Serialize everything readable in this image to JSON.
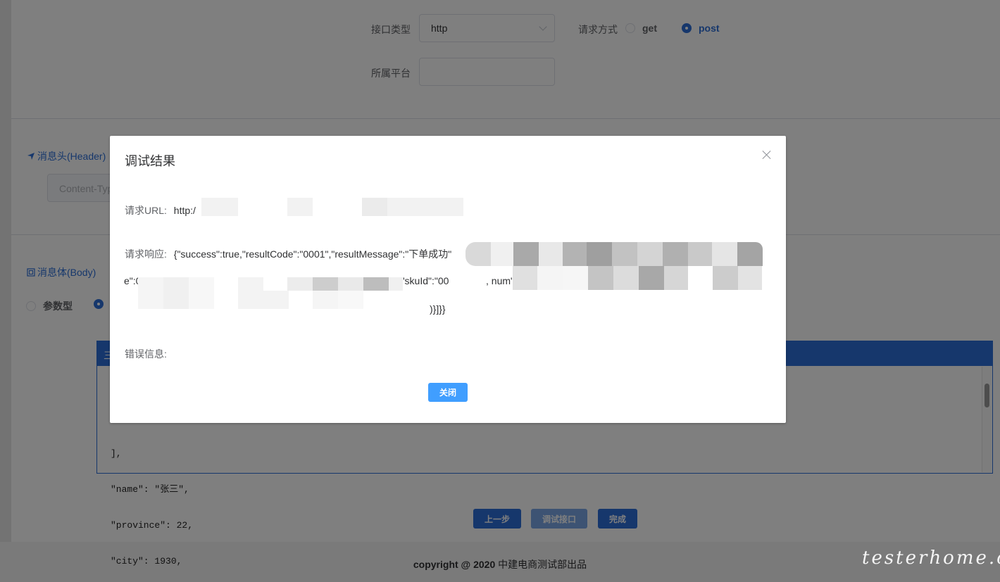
{
  "form": {
    "interface_type_label": "接口类型",
    "interface_type_value": "http",
    "method_label": "请求方式",
    "method_options": [
      "get",
      "post"
    ],
    "method_selected": "post",
    "platform_label": "所属平台"
  },
  "header_section": {
    "title": "消息头(Header)",
    "content_type_placeholder": "Content-Typ"
  },
  "body_section": {
    "title": "消息体(Body)",
    "type_options": [
      "参数型",
      ""
    ],
    "type_selected_index": 1,
    "menu_glyph": "三",
    "code_lines": [
      "],",
      "\"name\": \"张三\",",
      "\"province\": 22,",
      "\"city\": 1930,"
    ]
  },
  "actions": {
    "prev_label": "上一步",
    "debug_label": "调试接口",
    "finish_label": "完成"
  },
  "footer": {
    "copyright_bold": "copyright @ 2020",
    "org": "中建电商测试部出品"
  },
  "watermark": "testerhome.com",
  "dialog": {
    "title": "调试结果",
    "url_label": "请求URL:",
    "url_value": "http:/",
    "response_label": "请求响应:",
    "response_line1": "{\"success\":true,\"resultCode\":\"0001\",\"resultMessage\":\"下单成功\"",
    "response_line2_start": "e\":06",
    "response_line2_mid": "[{\"skuId\":\"00",
    "response_line2_end": ", num\":3,\"price\":30,\"na",
    "response_line3_end": ")}]}}",
    "error_label": "错误信息:",
    "close_label": "关闭"
  },
  "colors": {
    "primary": "#2d6fd8",
    "dialog_button": "#409eff"
  }
}
